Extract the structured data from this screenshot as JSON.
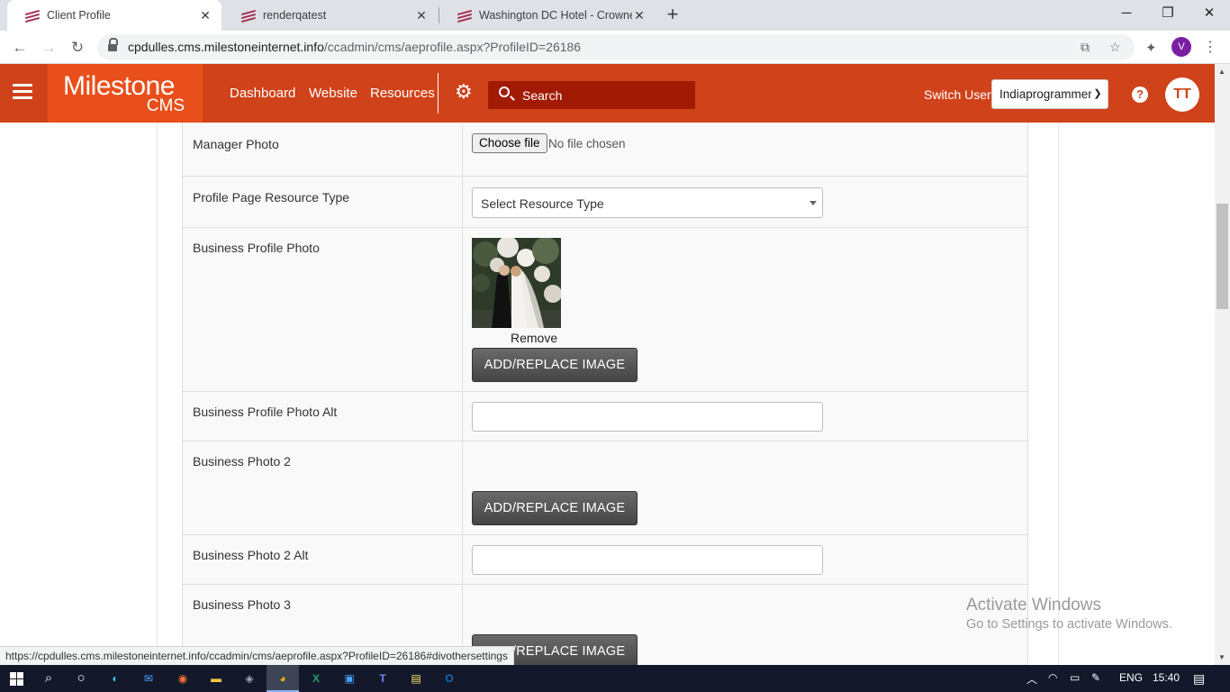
{
  "browser": {
    "tabs": [
      {
        "title": "Client Profile",
        "active": true
      },
      {
        "title": "renderqatest",
        "active": false
      },
      {
        "title": "Washington DC Hotel - Crowne P",
        "active": false
      }
    ],
    "url_host": "cpdulles.cms.milestoneinternet.info",
    "url_path": "/ccadmin/cms/aeprofile.aspx?ProfileID=26186",
    "profile_initial": "V"
  },
  "header": {
    "logo_line1": "Milestone",
    "logo_line2": "CMS",
    "nav": [
      "Dashboard",
      "Website",
      "Resources"
    ],
    "search_placeholder": "Search",
    "switch_user_label": "Switch User",
    "switch_user_value": "Indiaprogrammer",
    "help": "?",
    "avatar": "TT"
  },
  "form": {
    "manager_photo_label": "Manager Photo",
    "choose_file": "Choose file",
    "no_file": "No file chosen",
    "resource_type_label": "Profile Page Resource Type",
    "resource_type_value": "Select Resource Type",
    "business_profile_photo_label": "Business Profile Photo",
    "remove": "Remove",
    "add_replace": "ADD/REPLACE IMAGE",
    "business_profile_photo_alt_label": "Business Profile Photo Alt",
    "business_photo_2_label": "Business Photo 2",
    "business_photo_2_alt_label": "Business Photo 2 Alt",
    "business_photo_3_label": "Business Photo 3"
  },
  "watermark": {
    "line1": "Activate Windows",
    "line2": "Go to Settings to activate Windows."
  },
  "status_url": "https://cpdulles.cms.milestoneinternet.info/ccadmin/cms/aeprofile.aspx?ProfileID=26186#divothersettings",
  "taskbar": {
    "lang": "ENG",
    "time": "15:40"
  }
}
